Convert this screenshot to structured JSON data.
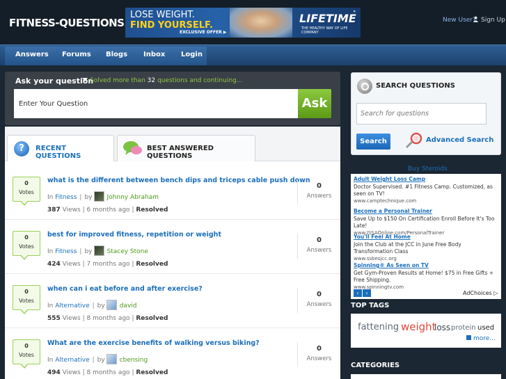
{
  "header": {
    "logo": "FITNESS-QUESTIONS.COM",
    "banner": {
      "line1": "LOSE WEIGHT.",
      "line2": "FIND YOURSELF.",
      "offer": "EXCLUSIVE OFFER ▶",
      "brand": "LIFETIME",
      "tagline": "THE HEALTHY WAY OF LIFE COMPANY"
    },
    "new_user": "New User?",
    "sign_up": "Sign Up"
  },
  "nav": {
    "items": [
      {
        "label": "Answers"
      },
      {
        "label": "Forums"
      },
      {
        "label": "Blogs"
      },
      {
        "label": "Inbox"
      },
      {
        "label": "Login"
      }
    ]
  },
  "ask": {
    "label": "Ask your question",
    "solved_prefix": "Solved more than",
    "solved_count": "32",
    "solved_suffix": "questions and continuing...",
    "input_value": "Enter Your Question",
    "button": "Ask"
  },
  "tabs": {
    "recent": "RECENT QUESTIONS",
    "best": "BEST ANSWERED QUESTIONS"
  },
  "questions": [
    {
      "votes": "0",
      "votes_label": "Votes",
      "title": "what is the different between bench dips and triceps cable push down",
      "in": "In",
      "category": "Fitness",
      "by": "by",
      "user": "Johnny Abraham",
      "views": "387",
      "views_label": "Views",
      "time": "6 months ago",
      "status": "Resolved",
      "answers": "0",
      "answers_label": "Answers"
    },
    {
      "votes": "0",
      "votes_label": "Votes",
      "title": "best for improved fitness, repetition or weight",
      "in": "In",
      "category": "Fitness",
      "by": "by",
      "user": "Stacey Stone",
      "views": "424",
      "views_label": "Views",
      "time": "7 months ago",
      "status": "Resolved",
      "answers": "0",
      "answers_label": "Answers"
    },
    {
      "votes": "0",
      "votes_label": "Votes",
      "title": "when can i eat before and after exercise?",
      "in": "In",
      "category": "Alternative",
      "by": "by",
      "user": "david",
      "views": "555",
      "views_label": "Views",
      "time": "8 months ago",
      "status": "Resolved",
      "answers": "0",
      "answers_label": "Answers"
    },
    {
      "votes": "0",
      "votes_label": "Votes",
      "title": "What are the exercise benefits of walking versus biking?",
      "in": "In",
      "category": "Alternative",
      "by": "by",
      "user": "cbensing",
      "views": "494",
      "views_label": "Views",
      "time": "8 months ago",
      "status": "Resolved",
      "answers": "0",
      "answers_label": "Answers"
    }
  ],
  "search": {
    "title": "SEARCH QUESTIONS",
    "placeholder": "Search for questions",
    "button": "Search",
    "advanced": "Advanced Search"
  },
  "buy_steroids": "Buy Steroids",
  "ads": [
    {
      "title": "Adult Weight Loss Camp",
      "desc": "Doctor Supervised. #1 Fitness Camp. Customized, as seen on TV!",
      "url": "www.camptechnique.com"
    },
    {
      "title": "Become a Personal Trainer",
      "desc": "Save Up to $150 On Certification Enroll Before It's Too Late!",
      "url": "www.ISSAOnline.com/PersonalTrainer"
    },
    {
      "title": "You'll Feel At Home",
      "desc": "Join the Club at the JCC in June Free Body Transformation Class",
      "url": "www.ssbesjcc.org"
    },
    {
      "title": "Spinning® As Seen on TV",
      "desc": "Get Gym-Proven Results at Home! $75 in Free Gifts + Free Shipping.",
      "url": "www.spinningtv.com"
    }
  ],
  "adchoices": "AdChoices ▷",
  "top_tags": {
    "heading": "TOP TAGS",
    "tags": [
      {
        "text": "fattening",
        "color": "#5f6b77"
      },
      {
        "text": "weight",
        "color": "#e0483a"
      },
      {
        "text": "loss",
        "color": "#3b4753"
      },
      {
        "text": "protein",
        "color": "#5f6b77"
      },
      {
        "text": "used",
        "color": "#222222"
      }
    ],
    "more": "more..."
  },
  "categories": {
    "heading": "CATEGORIES"
  },
  "colors": {
    "accent_blue": "#1b6fba",
    "accent_green": "#8bc93f",
    "nav_bg": "#1c416d"
  }
}
